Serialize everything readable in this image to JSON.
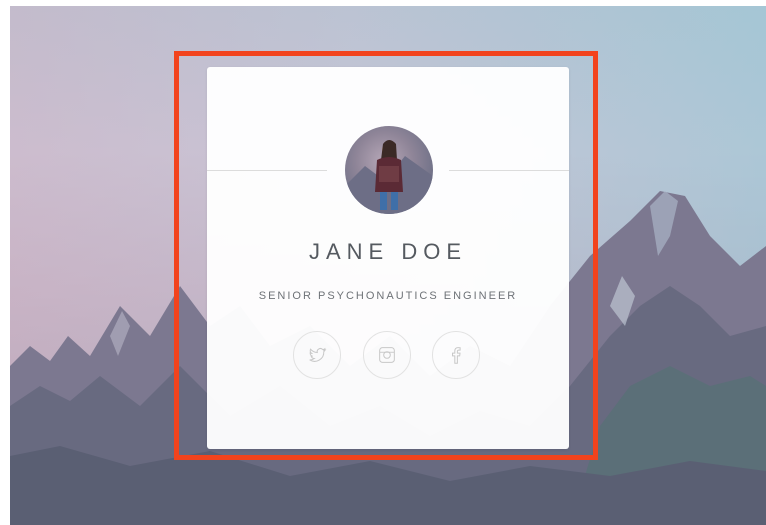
{
  "profile": {
    "name": "JANE DOE",
    "role": "SENIOR PSYCHONAUTICS ENGINEER"
  },
  "socials": [
    {
      "icon": "twitter-icon"
    },
    {
      "icon": "instagram-icon"
    },
    {
      "icon": "facebook-icon"
    }
  ],
  "colors": {
    "highlight_border": "#f2431d",
    "card_background": "#ffffff",
    "text": "#555a60"
  }
}
